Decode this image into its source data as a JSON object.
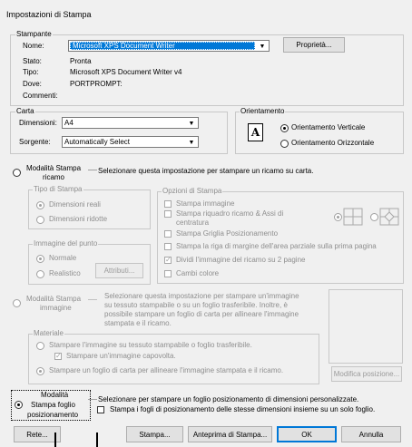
{
  "title": "Impostazioni di Stampa",
  "printer": {
    "group": "Stampante",
    "name_label": "Nome:",
    "name_value": "Microsoft XPS Document Writer",
    "properties_button": "Proprietà...",
    "status_label": "Stato:",
    "status_value": "Pronta",
    "type_label": "Tipo:",
    "type_value": "Microsoft XPS Document Writer v4",
    "where_label": "Dove:",
    "where_value": "PORTPROMPT:",
    "comment_label": "Commenti:"
  },
  "paper": {
    "group": "Carta",
    "size_label": "Dimensioni:",
    "size_value": "A4",
    "source_label": "Sorgente:",
    "source_value": "Automatically Select"
  },
  "orientation": {
    "group": "Orientamento",
    "portrait": "Orientamento Verticale",
    "landscape": "Orientamento Orizzontale",
    "icon_letter": "A",
    "selected": "portrait"
  },
  "mode_embroidery": {
    "label_line1": "Modalità Stampa",
    "label_line2": "ricamo",
    "description": "Selezionare questa impostazione per stampare un ricamo su carta.",
    "print_type": {
      "group": "Tipo di Stampa",
      "actual": "Dimensioni reali",
      "reduced": "Dimensioni ridotte"
    },
    "stitch_image": {
      "group": "Immagine del punto",
      "normal": "Normale",
      "realistic": "Realistico",
      "attributes_button": "Attributi..."
    },
    "print_options": {
      "group": "Opzioni di Stampa",
      "print_image": "Stampa immagine",
      "frame_line1": "Stampa riquadro ricamo & Assi di",
      "frame_line2": "centratura",
      "grid": "Stampa Griglia Posizionamento",
      "margin_line": "Stampa la riga di margine dell'area parziale sulla prima pagina",
      "split_image": "Dividi l'immagine del ricamo su 2 pagine",
      "color_changes": "Cambi colore"
    }
  },
  "mode_image": {
    "label_line1": "Modalità Stampa",
    "label_line2": "immagine",
    "description": [
      "Selezionare questa impostazione per stampare un'immagine",
      "su tessuto stampabile o su un foglio trasferibile. Inoltre, è",
      "possibile stampare un foglio di carta per allineare l'immagine",
      "stampata e il ricamo."
    ],
    "material": {
      "group": "Materiale",
      "fabric": "Stampare l'immagine su tessuto stampabile o foglio trasferibile.",
      "mirror": "Stampare un'immagine capovolta.",
      "paper_sheet": "Stampare un foglio di carta per allineare l'immagine stampata e il ricamo."
    },
    "modify_position_button": "Modifica posizione..."
  },
  "mode_sheet": {
    "label_line1": "Modalità",
    "label_line2": "Stampa foglio",
    "label_line3": "posizionamento",
    "description": "Selezionare per stampare un foglio posizionamento di dimensioni personalizzate.",
    "same_size_option": "Stampa i fogli di posizionamento delle stesse dimensioni insieme su un solo foglio."
  },
  "buttons": {
    "net": "Rete...",
    "print": "Stampa...",
    "preview": "Anteprima di Stampa...",
    "ok": "OK",
    "cancel": "Annulla"
  },
  "colors": {
    "selection": "#0078d7",
    "disabled_text": "#8e8e8e",
    "dialog_bg": "#f0f0f0"
  }
}
